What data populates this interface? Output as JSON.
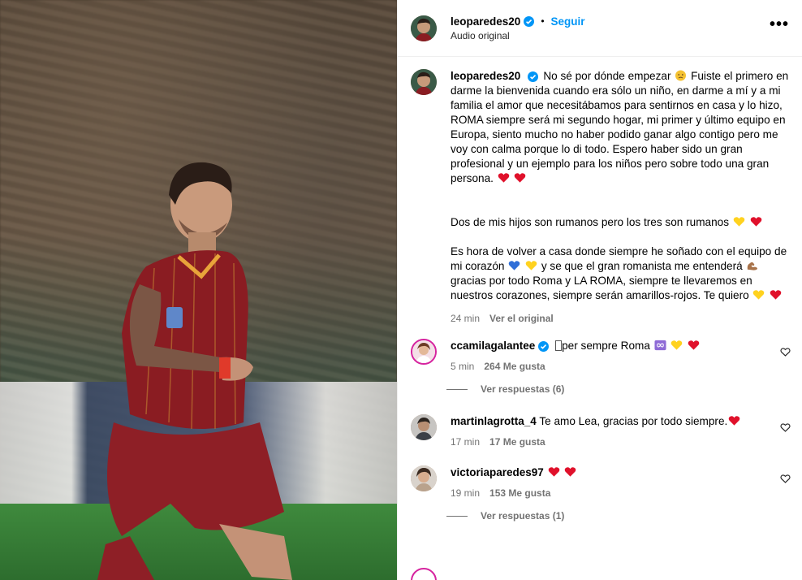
{
  "post": {
    "username": "leoparedes20",
    "follow_label": "Seguir",
    "audio": "Audio original",
    "more": "•••",
    "dot": "•"
  },
  "caption": {
    "username": "leoparedes20",
    "p1_a": "No sé por dónde empezar",
    "p1_b": "Fuiste el primero en darme la bienvenida cuando era sólo un niño, en darme a mí y a mi familia el amor que necesitábamos para sentirnos en casa y lo hizo, ROMA siempre será mi segundo hogar, mi primer y último equipo en Europa, siento mucho no haber podido ganar algo contigo pero me voy con calma porque lo di todo. Espero haber sido un gran profesional y un ejemplo para los niños pero sobre todo una gran persona.",
    "p2": "Dos de mis hijos son rumanos pero los tres son rumanos",
    "p3_a": "Es hora de volver a casa donde siempre he soñado con el equipo de mi corazón",
    "p3_b": "y se que el gran romanista me entenderá",
    "p3_c": "gracias por todo Roma y LA ROMA, siempre te llevaremos en nuestros corazones, siempre serán amarillos-rojos. Te quiero",
    "time": "24 min",
    "see_original": "Ver el original"
  },
  "comments": [
    {
      "username": "ccamilagalantee",
      "text": "per sempre Roma",
      "time": "5 min",
      "likes": "264 Me gusta",
      "replies": "Ver respuestas (6)"
    },
    {
      "username": "martinlagrotta_4",
      "text": "Te amo Lea, gracias por todo siempre.",
      "time": "17 min",
      "likes": "17 Me gusta"
    },
    {
      "username": "victoriaparedes97",
      "text": "",
      "time": "19 min",
      "likes": "153 Me gusta",
      "replies": "Ver respuestas (1)"
    }
  ],
  "colors": {
    "link": "#0095f6",
    "verified": "#0095f6",
    "secondary": "#737373",
    "heart_red": "#e0112b",
    "heart_yellow": "#ffd21f",
    "heart_blue": "#2f6fd8",
    "jersey": "#8a1c22"
  },
  "icons": [
    "verified-badge-icon",
    "more-options-icon",
    "heart-outline-icon",
    "sad-face-emoji",
    "red-heart-emoji",
    "yellow-heart-emoji",
    "blue-heart-emoji",
    "flexed-biceps-emoji",
    "infinity-emoji"
  ]
}
